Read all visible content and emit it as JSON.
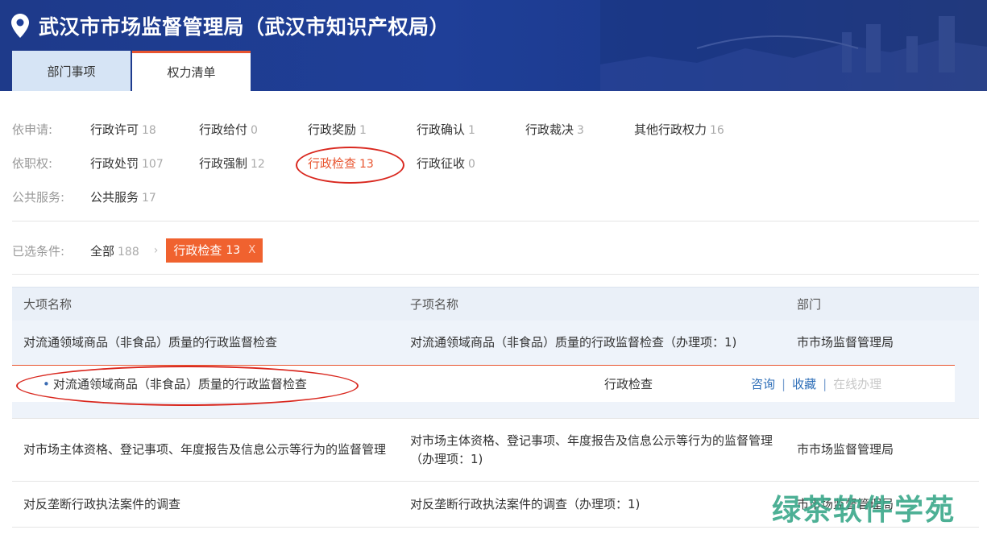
{
  "header": {
    "title": "武汉市市场监督管理局（武汉市知识产权局）",
    "tabs": [
      {
        "label": "部门事项"
      },
      {
        "label": "权力清单"
      }
    ]
  },
  "filters": {
    "rows": [
      {
        "label": "依申请:",
        "items": [
          {
            "name": "行政许可",
            "count": "18"
          },
          {
            "name": "行政给付",
            "count": "0"
          },
          {
            "name": "行政奖励",
            "count": "1"
          },
          {
            "name": "行政确认",
            "count": "1"
          },
          {
            "name": "行政裁决",
            "count": "3"
          },
          {
            "name": "其他行政权力",
            "count": "16"
          }
        ]
      },
      {
        "label": "依职权:",
        "items": [
          {
            "name": "行政处罚",
            "count": "107"
          },
          {
            "name": "行政强制",
            "count": "12"
          },
          {
            "name": "行政检查",
            "count": "13"
          },
          {
            "name": "行政征收",
            "count": "0"
          }
        ]
      },
      {
        "label": "公共服务:",
        "items": [
          {
            "name": "公共服务",
            "count": "17"
          }
        ]
      }
    ]
  },
  "conditions": {
    "label": "已选条件:",
    "all_name": "全部",
    "all_count": "188",
    "chevron": "›",
    "tag_name": "行政检查",
    "tag_count": "13",
    "tag_close": "X"
  },
  "table": {
    "headers": [
      "大项名称",
      "子项名称",
      "部门"
    ],
    "rows": [
      {
        "main": "对流通领域商品（非食品）质量的行政监督检查",
        "sub": "对流通领域商品（非食品）质量的行政监督检查（办理项：1)",
        "dept": "市市场监督管理局"
      },
      {
        "main": "对市场主体资格、登记事项、年度报告及信息公示等行为的监督管理",
        "sub": "对市场主体资格、登记事项、年度报告及信息公示等行为的监督管理（办理项：1)",
        "dept": "市市场监督管理局"
      },
      {
        "main": "对反垄断行政执法案件的调查",
        "sub": "对反垄断行政执法案件的调查（办理项：1)",
        "dept": "市市场监督管理局"
      }
    ],
    "expanded": {
      "name": "对流通领域商品（非食品）质量的行政监督检查",
      "type": "行政检查",
      "actions": [
        "咨询",
        "收藏",
        "在线办理"
      ]
    }
  },
  "watermark": "绿茶软件学苑",
  "colors": {
    "header_bg": "#1f3f98",
    "accent": "#e8542f",
    "link": "#2f6fb8",
    "annotation": "#d9281f"
  }
}
